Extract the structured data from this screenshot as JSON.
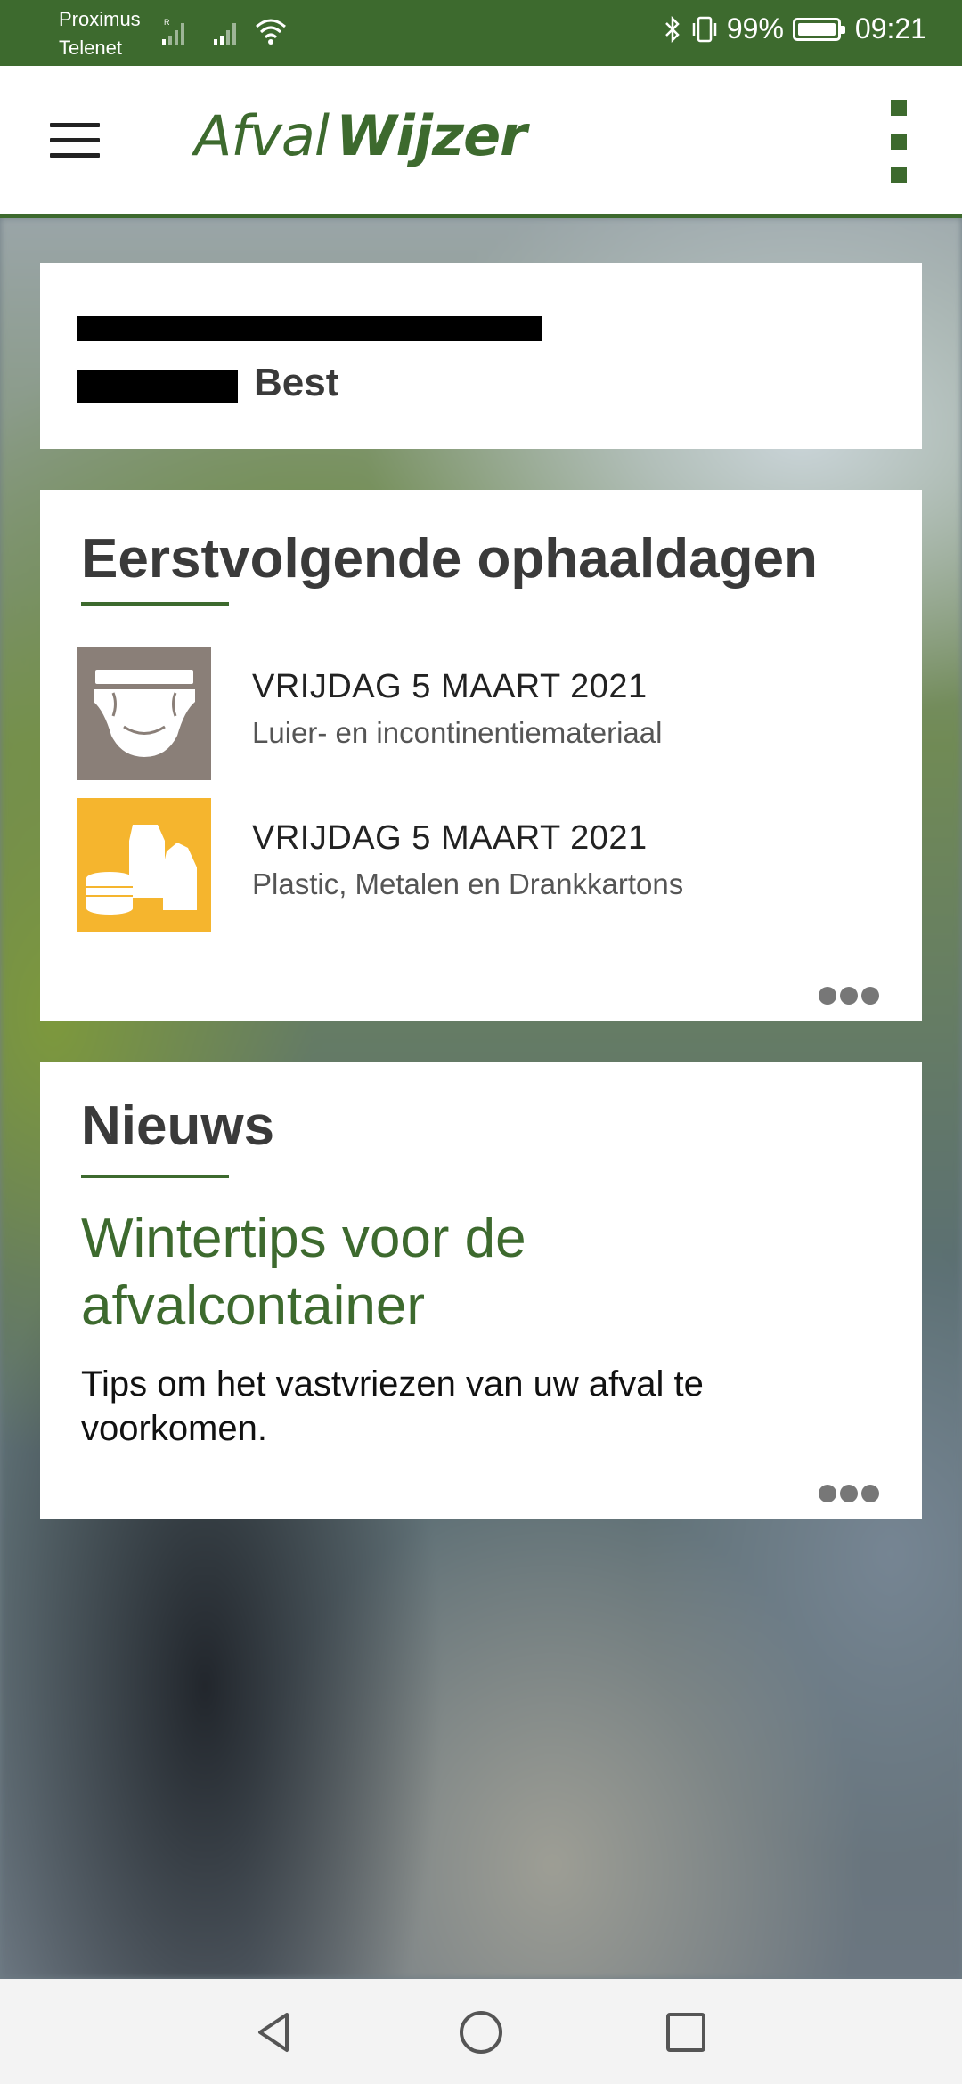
{
  "status_bar": {
    "carrier_1": "Proximus",
    "carrier_2": "Telenet",
    "battery": "99%",
    "time": "09:21",
    "icons": [
      "signal-icon",
      "wifi-icon",
      "bluetooth-icon",
      "vibrate-icon",
      "battery-icon"
    ]
  },
  "app_bar": {
    "logo_part1": "Afval",
    "logo_part2": "Wijzer",
    "menu_icon": "hamburger-icon",
    "overflow_icon": "more-vert-icon",
    "accent_color": "#3d6a2e"
  },
  "address": {
    "line1": "",
    "line2": "Best"
  },
  "pickup": {
    "title": "Eerstvolgende ophaaldagen",
    "items": [
      {
        "date": "VRIJDAG 5 MAART 2021",
        "type": "Luier- en incontinentiemateriaal",
        "icon": "diaper-icon",
        "icon_color": "#8a7f78"
      },
      {
        "date": "VRIJDAG 5 MAART 2021",
        "type": "Plastic, Metalen en Drankkartons",
        "icon": "plastic-metal-carton-icon",
        "icon_color": "#f5b52e"
      }
    ]
  },
  "news": {
    "title": "Nieuws",
    "headline": "Wintertips voor de afvalcontainer",
    "summary": "Tips om het vastvriezen van uw afval te voorkomen."
  },
  "nav_bar": {
    "icons": [
      "back-icon",
      "home-icon",
      "recents-icon"
    ]
  }
}
